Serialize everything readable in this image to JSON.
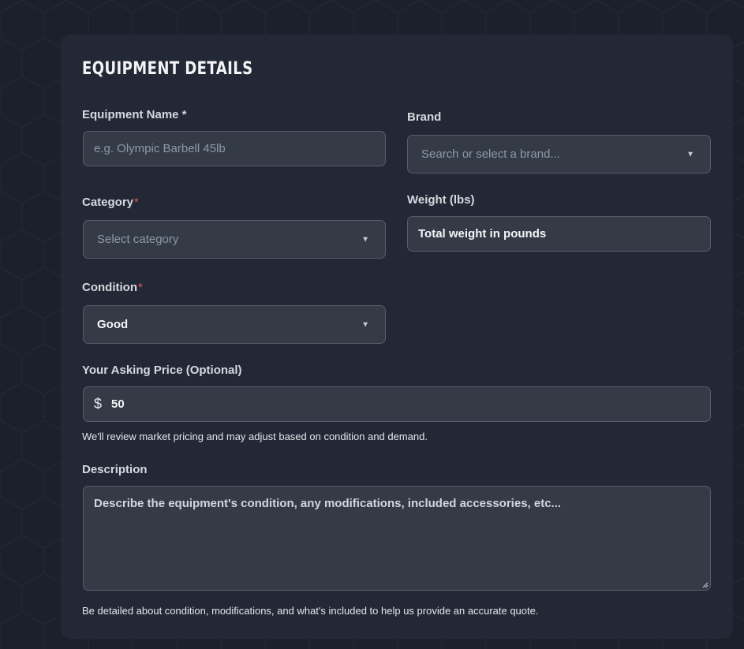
{
  "section": {
    "title": "EQUIPMENT DETAILS"
  },
  "fields": {
    "equipment_name": {
      "label": "Equipment Name *",
      "placeholder": "e.g. Olympic Barbell 45lb"
    },
    "brand": {
      "label": "Brand",
      "placeholder": "Search or select a brand..."
    },
    "category": {
      "label": "Category",
      "required_mark": "*",
      "placeholder": "Select category"
    },
    "weight": {
      "label": "Weight (lbs)",
      "value": "Total weight in pounds"
    },
    "condition": {
      "label": "Condition",
      "required_mark": "*",
      "value": "Good"
    },
    "price": {
      "label": "Your Asking Price (Optional)",
      "currency_symbol": "$",
      "value": "50",
      "help": "We'll review market pricing and may adjust based on condition and demand."
    },
    "description": {
      "label": "Description",
      "value": "Describe the equipment's condition, any modifications, included accessories, etc...",
      "help": "Be detailed about condition, modifications, and what's included to help us provide an accurate quote."
    }
  },
  "icons": {
    "dropdown": "chevron-down-icon",
    "resize": "resize-handle-icon"
  },
  "glyphs": {
    "caret": "▼"
  },
  "colors": {
    "page_bg": "#1b202b",
    "card_bg": "#232836",
    "field_bg": "#353a47",
    "field_border": "#565c69",
    "required": "#e05252"
  }
}
